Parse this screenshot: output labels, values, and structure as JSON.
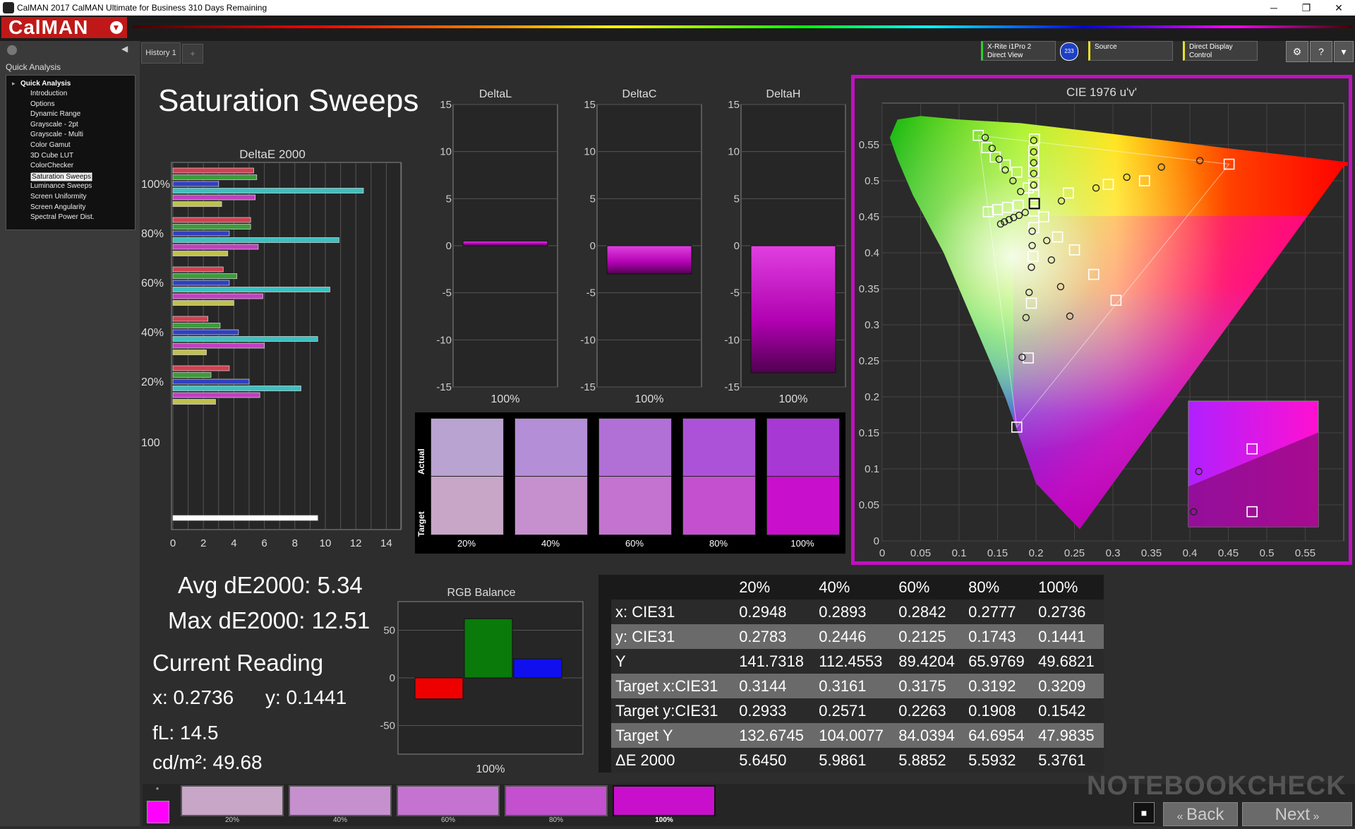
{
  "window": {
    "title": "CalMAN 2017 CalMAN Ultimate for Business 310 Days Remaining",
    "controls": [
      "─",
      "❐",
      "✕"
    ]
  },
  "header": {
    "logo": "CalMAN"
  },
  "sidebar": {
    "header": "Quick Analysis",
    "root": "Quick Analysis",
    "items": [
      {
        "label": "Introduction"
      },
      {
        "label": "Options"
      },
      {
        "label": "Dynamic Range"
      },
      {
        "label": "Grayscale - 2pt"
      },
      {
        "label": "Grayscale - Multi"
      },
      {
        "label": "Color Gamut"
      },
      {
        "label": "3D Cube LUT"
      },
      {
        "label": "ColorChecker"
      },
      {
        "label": "Saturation Sweeps",
        "selected": true
      },
      {
        "label": "Luminance Sweeps"
      },
      {
        "label": "Screen Uniformity"
      },
      {
        "label": "Screen Angularity"
      },
      {
        "label": "Spectral Power Dist."
      }
    ]
  },
  "tabs": {
    "history": "History 1",
    "add": "+"
  },
  "toolbar": {
    "meter": "X-Rite i1Pro 2 Direct View",
    "meter_badge": "233",
    "source": "Source",
    "display": "Direct Display Control",
    "settings_icon": "gear-icon",
    "help_icon": "help-icon"
  },
  "page_title": "Saturation Sweeps",
  "deltae_chart": {
    "title": "DeltaE 2000",
    "ylabels": [
      "100%",
      "80%",
      "60%",
      "40%",
      "20%",
      "100"
    ],
    "xticks": [
      "0",
      "2",
      "4",
      "6",
      "8",
      "10",
      "12",
      "14"
    ]
  },
  "delta_charts": [
    {
      "title": "DeltaL",
      "label": "100%",
      "value": 0.5
    },
    {
      "title": "DeltaC",
      "label": "100%",
      "value": -3
    },
    {
      "title": "DeltaH",
      "label": "100%",
      "value": -13.5
    }
  ],
  "delta_ticks": [
    "15",
    "10",
    "5",
    "0",
    "-5",
    "-10",
    "-15"
  ],
  "patch_panel": {
    "actual_label": "Actual",
    "target_label": "Target",
    "patches": [
      {
        "label": "20%",
        "actual": "#b9a3d1",
        "target": "#c8a6c8"
      },
      {
        "label": "40%",
        "actual": "#b48ed6",
        "target": "#c690cf"
      },
      {
        "label": "60%",
        "actual": "#b070d6",
        "target": "#c474d0"
      },
      {
        "label": "80%",
        "actual": "#ac52d8",
        "target": "#c450d0"
      },
      {
        "label": "100%",
        "actual": "#a838d4",
        "target": "#c810cc"
      }
    ]
  },
  "stats": {
    "avg": "Avg dE2000: 5.34",
    "max": "Max dE2000: 12.51",
    "current_reading": "Current Reading",
    "x": "x: 0.2736",
    "y": "y: 0.1441",
    "fl": "fL: 14.5",
    "cdm2": "cd/m²: 49.68"
  },
  "rgb_balance": {
    "title": "RGB Balance",
    "label": "100%",
    "ticks": [
      "50",
      "0",
      "-50"
    ],
    "values": {
      "red": -22,
      "green": 62,
      "blue": 20
    }
  },
  "cie": {
    "title": "CIE 1976 u'v'",
    "xticks": [
      "0",
      "0.05",
      "0.1",
      "0.15",
      "0.2",
      "0.25",
      "0.3",
      "0.35",
      "0.4",
      "0.45",
      "0.5",
      "0.55"
    ],
    "yticks": [
      "0",
      "0.05",
      "0.1",
      "0.15",
      "0.2",
      "0.25",
      "0.3",
      "0.35",
      "0.4",
      "0.45",
      "0.5",
      "0.55"
    ],
    "gamut": [
      [
        0.451,
        0.523
      ],
      [
        0.125,
        0.563
      ],
      [
        0.175,
        0.158
      ]
    ],
    "white": [
      0.1978,
      0.4683
    ],
    "targets": [
      [
        0.125,
        0.563
      ],
      [
        0.136,
        0.546
      ],
      [
        0.147,
        0.533
      ],
      [
        0.16,
        0.522
      ],
      [
        0.175,
        0.512
      ],
      [
        0.19,
        0.49
      ],
      [
        0.198,
        0.558
      ],
      [
        0.197,
        0.542
      ],
      [
        0.197,
        0.528
      ],
      [
        0.197,
        0.513
      ],
      [
        0.197,
        0.495
      ],
      [
        0.197,
        0.48
      ],
      [
        0.138,
        0.457
      ],
      [
        0.15,
        0.46
      ],
      [
        0.163,
        0.463
      ],
      [
        0.177,
        0.466
      ],
      [
        0.197,
        0.458
      ],
      [
        0.197,
        0.435
      ],
      [
        0.196,
        0.395
      ],
      [
        0.194,
        0.33
      ],
      [
        0.19,
        0.254
      ],
      [
        0.175,
        0.158
      ],
      [
        0.21,
        0.45
      ],
      [
        0.228,
        0.422
      ],
      [
        0.25,
        0.404
      ],
      [
        0.275,
        0.37
      ],
      [
        0.304,
        0.334
      ],
      [
        0.242,
        0.483
      ],
      [
        0.294,
        0.495
      ],
      [
        0.341,
        0.5
      ],
      [
        0.451,
        0.523
      ]
    ],
    "measured": [
      [
        0.134,
        0.56
      ],
      [
        0.143,
        0.545
      ],
      [
        0.152,
        0.53
      ],
      [
        0.16,
        0.515
      ],
      [
        0.17,
        0.5
      ],
      [
        0.18,
        0.485
      ],
      [
        0.197,
        0.556
      ],
      [
        0.197,
        0.54
      ],
      [
        0.197,
        0.525
      ],
      [
        0.197,
        0.51
      ],
      [
        0.197,
        0.494
      ],
      [
        0.154,
        0.44
      ],
      [
        0.159,
        0.443
      ],
      [
        0.165,
        0.446
      ],
      [
        0.171,
        0.449
      ],
      [
        0.178,
        0.452
      ],
      [
        0.186,
        0.456
      ],
      [
        0.195,
        0.43
      ],
      [
        0.195,
        0.41
      ],
      [
        0.194,
        0.38
      ],
      [
        0.191,
        0.345
      ],
      [
        0.187,
        0.31
      ],
      [
        0.182,
        0.255
      ],
      [
        0.214,
        0.417
      ],
      [
        0.22,
        0.39
      ],
      [
        0.232,
        0.353
      ],
      [
        0.244,
        0.312
      ],
      [
        0.233,
        0.472
      ],
      [
        0.278,
        0.49
      ],
      [
        0.318,
        0.505
      ],
      [
        0.363,
        0.519
      ],
      [
        0.413,
        0.528
      ]
    ],
    "inset_targets": [
      [
        0.49,
        0.62
      ],
      [
        0.49,
        0.12
      ]
    ],
    "inset_measured": [
      [
        0.08,
        0.44
      ],
      [
        0.04,
        0.12
      ]
    ]
  },
  "table": {
    "headers": [
      "",
      "20%",
      "40%",
      "60%",
      "80%",
      "100%"
    ],
    "rows": [
      [
        "x: CIE31",
        "0.2948",
        "0.2893",
        "0.2842",
        "0.2777",
        "0.2736"
      ],
      [
        "y: CIE31",
        "0.2783",
        "0.2446",
        "0.2125",
        "0.1743",
        "0.1441"
      ],
      [
        "Y",
        "141.7318",
        "112.4553",
        "89.4204",
        "65.9769",
        "49.6821"
      ],
      [
        "Target x:CIE31",
        "0.3144",
        "0.3161",
        "0.3175",
        "0.3192",
        "0.3209"
      ],
      [
        "Target y:CIE31",
        "0.2933",
        "0.2571",
        "0.2263",
        "0.1908",
        "0.1542"
      ],
      [
        "Target Y",
        "132.6745",
        "104.0077",
        "84.0394",
        "64.6954",
        "47.9835"
      ],
      [
        "ΔE 2000",
        "5.6450",
        "5.9861",
        "5.8852",
        "5.5932",
        "5.3761"
      ]
    ]
  },
  "bottom_swatches": [
    {
      "label": "20%",
      "color": "#c8a6c8"
    },
    {
      "label": "40%",
      "color": "#c690cf"
    },
    {
      "label": "60%",
      "color": "#c474d0"
    },
    {
      "label": "80%",
      "color": "#c450d0"
    },
    {
      "label": "100%",
      "color": "#c810cc"
    }
  ],
  "current_swatch_color": "#ff00ff",
  "nav": {
    "back": "Back",
    "next": "Next"
  },
  "watermark": "NOTEBOOKCHECK"
}
